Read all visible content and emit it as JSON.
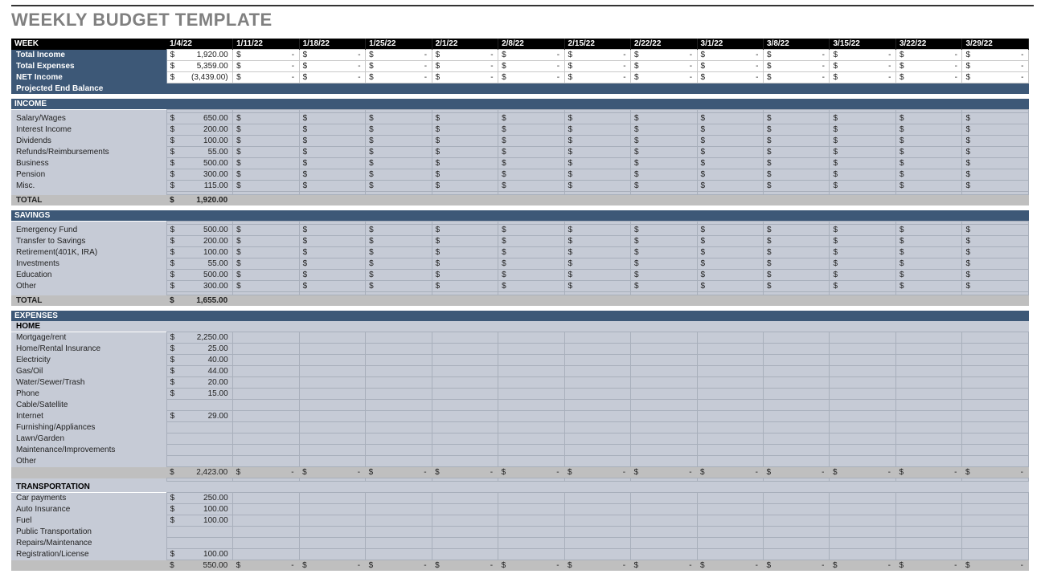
{
  "title": "WEEKLY BUDGET TEMPLATE",
  "weekLabel": "WEEK",
  "weeks": [
    "1/4/22",
    "1/11/22",
    "1/18/22",
    "1/25/22",
    "2/1/22",
    "2/8/22",
    "2/15/22",
    "2/22/22",
    "3/1/22",
    "3/8/22",
    "3/15/22",
    "3/22/22",
    "3/29/22"
  ],
  "summary": [
    {
      "label": "Total Income",
      "values": [
        "1,920.00",
        "-",
        "-",
        "-",
        "-",
        "-",
        "-",
        "-",
        "-",
        "-",
        "-",
        "-",
        "-"
      ]
    },
    {
      "label": "Total Expenses",
      "values": [
        "5,359.00",
        "-",
        "-",
        "-",
        "-",
        "-",
        "-",
        "-",
        "-",
        "-",
        "-",
        "-",
        "-"
      ]
    },
    {
      "label": "NET Income",
      "values": [
        "(3,439.00)",
        "-",
        "-",
        "-",
        "-",
        "-",
        "-",
        "-",
        "-",
        "-",
        "-",
        "-",
        "-"
      ]
    }
  ],
  "projLabel": "Projected End Balance",
  "sections": [
    {
      "name": "INCOME",
      "rows": [
        {
          "label": "Salary/Wages",
          "v": "650.00"
        },
        {
          "label": "Interest Income",
          "v": "200.00"
        },
        {
          "label": "Dividends",
          "v": "100.00"
        },
        {
          "label": "Refunds/Reimbursements",
          "v": "55.00"
        },
        {
          "label": "Business",
          "v": "500.00"
        },
        {
          "label": "Pension",
          "v": "300.00"
        },
        {
          "label": "Misc.",
          "v": "115.00"
        }
      ],
      "totalLabel": "TOTAL",
      "total": "1,920.00"
    },
    {
      "name": "SAVINGS",
      "rows": [
        {
          "label": "Emergency Fund",
          "v": "500.00"
        },
        {
          "label": "Transfer to Savings",
          "v": "200.00"
        },
        {
          "label": "Retirement(401K, IRA)",
          "v": "100.00"
        },
        {
          "label": "Investments",
          "v": "55.00"
        },
        {
          "label": "Education",
          "v": "500.00"
        },
        {
          "label": "Other",
          "v": "300.00"
        }
      ],
      "totalLabel": "TOTAL",
      "total": "1,655.00"
    }
  ],
  "expenses": {
    "header": "EXPENSES",
    "groups": [
      {
        "name": "HOME",
        "rows": [
          {
            "label": "Mortgage/rent",
            "v": "2,250.00"
          },
          {
            "label": "Home/Rental Insurance",
            "v": "25.00"
          },
          {
            "label": "Electricity",
            "v": "40.00"
          },
          {
            "label": "Gas/Oil",
            "v": "44.00"
          },
          {
            "label": "Water/Sewer/Trash",
            "v": "20.00"
          },
          {
            "label": "Phone",
            "v": "15.00"
          },
          {
            "label": "Cable/Satellite",
            "v": ""
          },
          {
            "label": "Internet",
            "v": "29.00"
          },
          {
            "label": "Furnishing/Appliances",
            "v": ""
          },
          {
            "label": "Lawn/Garden",
            "v": ""
          },
          {
            "label": "Maintenance/Improvements",
            "v": ""
          },
          {
            "label": "Other",
            "v": ""
          }
        ],
        "subtotal": "2,423.00"
      },
      {
        "name": "TRANSPORTATION",
        "rows": [
          {
            "label": "Car payments",
            "v": "250.00"
          },
          {
            "label": "Auto Insurance",
            "v": "100.00"
          },
          {
            "label": "Fuel",
            "v": "100.00"
          },
          {
            "label": "Public Transportation",
            "v": ""
          },
          {
            "label": "Repairs/Maintenance",
            "v": ""
          },
          {
            "label": "Registration/License",
            "v": "100.00"
          }
        ],
        "subtotal": "550.00"
      }
    ]
  }
}
